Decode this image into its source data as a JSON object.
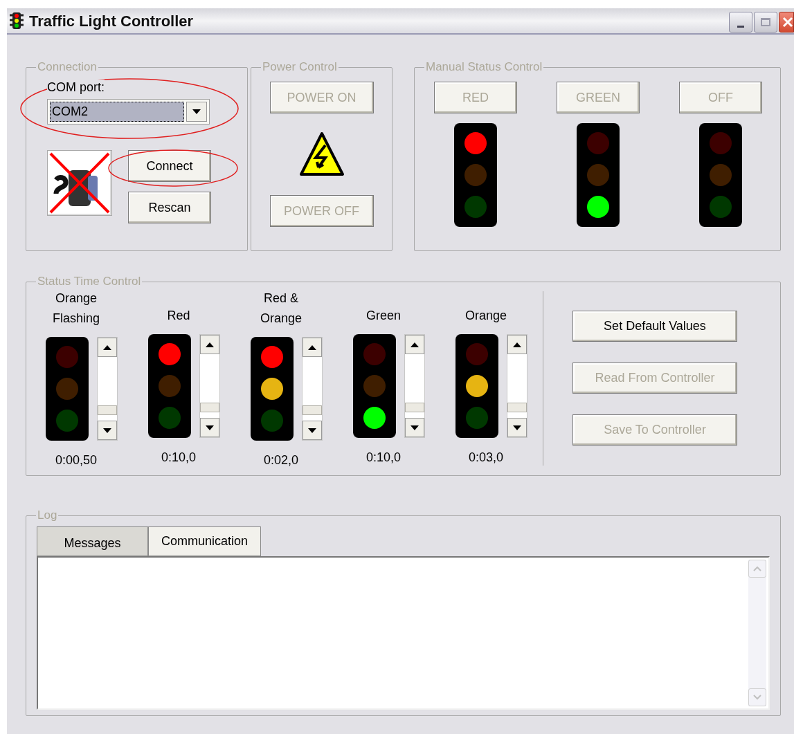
{
  "window": {
    "title": "Traffic Light Controller"
  },
  "connection": {
    "title": "Connection",
    "com_port_label": "COM port:",
    "com_port_value": "COM2",
    "buttons": [
      {
        "label": "Connect",
        "disabled": false
      },
      {
        "label": "Rescan",
        "disabled": false
      }
    ]
  },
  "power_control": {
    "title": "Power Control",
    "buttons": [
      {
        "label": "POWER ON",
        "disabled": true
      },
      {
        "label": "POWER OFF",
        "disabled": true
      }
    ]
  },
  "manual_status_control": {
    "title": "Manual Status Control",
    "items": [
      {
        "label": "RED",
        "disabled": true,
        "lamps": [
          {
            "kind": "red",
            "on": true
          },
          {
            "kind": "orange",
            "on": false
          },
          {
            "kind": "green",
            "on": false
          }
        ]
      },
      {
        "label": "GREEN",
        "disabled": true,
        "lamps": [
          {
            "kind": "red",
            "on": false
          },
          {
            "kind": "orange",
            "on": false
          },
          {
            "kind": "green",
            "on": true
          }
        ]
      },
      {
        "label": "OFF",
        "disabled": true,
        "lamps": [
          {
            "kind": "red",
            "on": false
          },
          {
            "kind": "orange",
            "on": false
          },
          {
            "kind": "green",
            "on": false
          }
        ]
      }
    ]
  },
  "status_time_control": {
    "title": "Status Time Control",
    "states": [
      {
        "label": "Orange Flashing",
        "time": "0:00,50",
        "lamps": [
          {
            "kind": "red",
            "on": false
          },
          {
            "kind": "orange",
            "on": false
          },
          {
            "kind": "green",
            "on": false
          }
        ]
      },
      {
        "label": "Red",
        "time": "0:10,0",
        "lamps": [
          {
            "kind": "red",
            "on": true
          },
          {
            "kind": "orange",
            "on": false
          },
          {
            "kind": "green",
            "on": false
          }
        ]
      },
      {
        "label": "Red & Orange",
        "time": "0:02,0",
        "lamps": [
          {
            "kind": "red",
            "on": true
          },
          {
            "kind": "orange",
            "on": true
          },
          {
            "kind": "green",
            "on": false
          }
        ]
      },
      {
        "label": "Green",
        "time": "0:10,0",
        "lamps": [
          {
            "kind": "red",
            "on": false
          },
          {
            "kind": "orange",
            "on": false
          },
          {
            "kind": "green",
            "on": true
          }
        ]
      },
      {
        "label": "Orange",
        "time": "0:03,0",
        "lamps": [
          {
            "kind": "red",
            "on": false
          },
          {
            "kind": "orange",
            "on": true
          },
          {
            "kind": "green",
            "on": false
          }
        ]
      }
    ],
    "buttons": [
      {
        "label": "Set Default Values",
        "disabled": false
      },
      {
        "label": "Read From Controller",
        "disabled": true
      },
      {
        "label": "Save To Controller",
        "disabled": true
      }
    ]
  },
  "log": {
    "title": "Log",
    "tabs": [
      {
        "label": "Messages",
        "selected": true
      },
      {
        "label": "Communication",
        "selected": false
      }
    ]
  }
}
